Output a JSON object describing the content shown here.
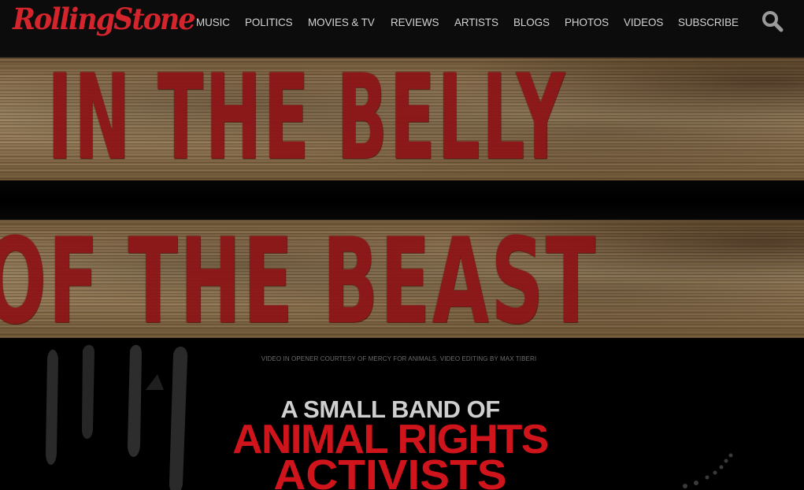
{
  "header": {
    "logo_text": "RollingStone",
    "nav": [
      {
        "label": "MUSIC"
      },
      {
        "label": "POLITICS"
      },
      {
        "label": "MOVIES & TV"
      },
      {
        "label": "REVIEWS"
      },
      {
        "label": "ARTISTS"
      },
      {
        "label": "BLOGS"
      },
      {
        "label": "PHOTOS"
      },
      {
        "label": "VIDEOS"
      },
      {
        "label": "SUBSCRIBE"
      }
    ],
    "search_icon": "search-icon"
  },
  "hero": {
    "title_line1": "IN THE BELLY",
    "title_line2": "OF THE BEAST",
    "credit": "VIDEO IN OPENER COURTESY OF MERCY FOR ANIMALS. VIDEO EDITING BY MAX TIBERI",
    "headline_small": "A SMALL BAND OF",
    "headline_line1": "ANIMAL RIGHTS",
    "headline_line2": "ACTIVISTS"
  },
  "colors": {
    "brand_red": "#d4242c",
    "headline_red": "#d0141c",
    "stencil_red": "#8d1416",
    "nav_text": "#d3d3d3",
    "background": "#000000"
  }
}
